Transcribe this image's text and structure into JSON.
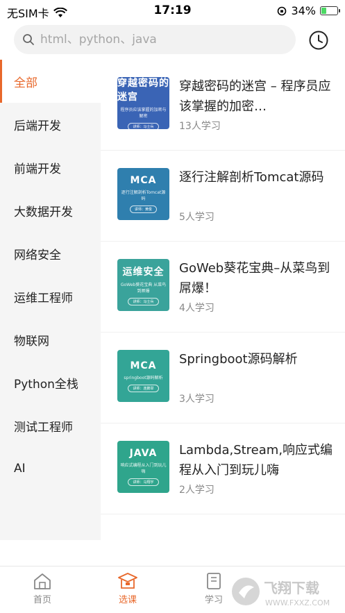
{
  "status_bar": {
    "carrier": "无SIM卡",
    "time": "17:19",
    "battery": "34%",
    "battery_level": 0.34
  },
  "search": {
    "placeholder": "html、python、java",
    "icon": "search-icon",
    "history_icon": "clock-icon"
  },
  "sidebar": {
    "items": [
      {
        "label": "全部",
        "active": true
      },
      {
        "label": "后端开发"
      },
      {
        "label": "前端开发"
      },
      {
        "label": "大数据开发"
      },
      {
        "label": "网络安全"
      },
      {
        "label": "运维工程师"
      },
      {
        "label": "物联网"
      },
      {
        "label": "Python全栈"
      },
      {
        "label": "测试工程师"
      },
      {
        "label": "AI"
      }
    ]
  },
  "courses": [
    {
      "title": "穿越密码的迷宫 – 程序员应该掌握的加密…",
      "count": "13人学习",
      "thumb": {
        "title": "穿越密码的迷宫",
        "sub": "程序员应该掌握的加密与解密",
        "tag": "讲师：马士兵",
        "color": "#3a64b5"
      }
    },
    {
      "title": "逐行注解剖析Tomcat源码",
      "count": "5人学习",
      "thumb": {
        "title": "MCA",
        "sub": "逐行注解剖析Tomcat源码",
        "tag": "讲师：黄俊",
        "color": "#2f7fae"
      }
    },
    {
      "title": "GoWeb葵花宝典–从菜鸟到屌爆！",
      "count": "4人学习",
      "thumb": {
        "title": "运维安全",
        "sub": "GoWeb葵花宝典 从菜鸟到屌爆",
        "tag": "讲师：马士兵",
        "color": "#3aa39b"
      }
    },
    {
      "title": "Springboot源码解析",
      "count": "3人学习",
      "thumb": {
        "title": "MCA",
        "sub": "springboot源码解析",
        "tag": "讲师：连鹏举",
        "color": "#33a596"
      }
    },
    {
      "title": "Lambda,Stream,响应式编程从入门到玩儿嗨",
      "count": "2人学习",
      "thumb": {
        "title": "JAVA",
        "sub": "响应式编程从入门到玩儿嗨",
        "tag": "讲师：马翔宇",
        "color": "#2fa58c"
      }
    }
  ],
  "bottom_nav": {
    "items": [
      {
        "label": "首页",
        "icon": "home-icon"
      },
      {
        "label": "选课",
        "icon": "course-icon",
        "active": true
      },
      {
        "label": "学习",
        "icon": "study-icon"
      }
    ],
    "accent": "#e8682b"
  },
  "watermark": {
    "text": "飞翔下载",
    "url": "WWW.FXXZ.COM"
  }
}
